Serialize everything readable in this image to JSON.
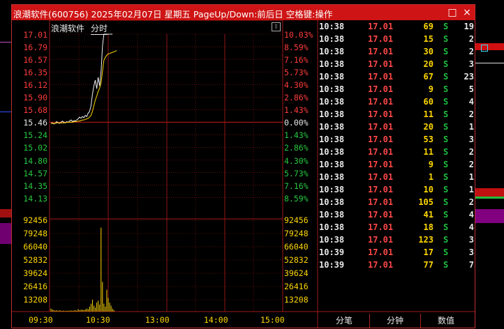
{
  "window": {
    "title": "浪潮软件(600756) 2025年02月07日 星期五 PageUp/Down:前后日 空格键:操作",
    "buttons": {
      "restore": "□",
      "close": "×"
    }
  },
  "chart": {
    "stock_name": "浪潮软件",
    "mode": "分时",
    "price_ticks": [
      "17.01",
      "16.79",
      "16.57",
      "16.35",
      "16.12",
      "15.90",
      "15.68",
      "15.46",
      "15.24",
      "15.02",
      "14.80",
      "14.57",
      "14.35",
      "14.13"
    ],
    "pct_ticks": [
      "10.03%",
      "8.59%",
      "7.16%",
      "5.73%",
      "4.30%",
      "2.86%",
      "1.43%",
      "0.00%",
      "1.43%",
      "2.86%",
      "4.30%",
      "5.73%",
      "7.16%",
      "8.59%"
    ],
    "volume_ticks": [
      "92456",
      "79248",
      "66040",
      "52832",
      "39624",
      "26416",
      "13208"
    ],
    "time_ticks": [
      "09:30",
      "10:30",
      "13:00",
      "14:00",
      "15:00"
    ],
    "colors": {
      "up": "#ff3b3b",
      "down": "#27c840",
      "flat": "#e8e8e8",
      "grid": "#a01818",
      "volume": "#ffd700"
    }
  },
  "trades": [
    {
      "time": "10:38",
      "price": "17.01",
      "vol": "69",
      "bs": "S",
      "count": "19"
    },
    {
      "time": "10:38",
      "price": "17.01",
      "vol": "15",
      "bs": "S",
      "count": "2"
    },
    {
      "time": "10:38",
      "price": "17.01",
      "vol": "30",
      "bs": "S",
      "count": "2"
    },
    {
      "time": "10:38",
      "price": "17.01",
      "vol": "20",
      "bs": "S",
      "count": "3"
    },
    {
      "time": "10:38",
      "price": "17.01",
      "vol": "67",
      "bs": "S",
      "count": "23"
    },
    {
      "time": "10:38",
      "price": "17.01",
      "vol": "9",
      "bs": "S",
      "count": "5"
    },
    {
      "time": "10:38",
      "price": "17.01",
      "vol": "60",
      "bs": "S",
      "count": "4"
    },
    {
      "time": "10:38",
      "price": "17.01",
      "vol": "11",
      "bs": "S",
      "count": "2"
    },
    {
      "time": "10:38",
      "price": "17.01",
      "vol": "20",
      "bs": "S",
      "count": "1"
    },
    {
      "time": "10:38",
      "price": "17.01",
      "vol": "53",
      "bs": "S",
      "count": "3"
    },
    {
      "time": "10:38",
      "price": "17.01",
      "vol": "11",
      "bs": "S",
      "count": "2"
    },
    {
      "time": "10:38",
      "price": "17.01",
      "vol": "9",
      "bs": "S",
      "count": "2"
    },
    {
      "time": "10:38",
      "price": "17.01",
      "vol": "1",
      "bs": "S",
      "count": "1"
    },
    {
      "time": "10:38",
      "price": "17.01",
      "vol": "10",
      "bs": "S",
      "count": "1"
    },
    {
      "time": "10:38",
      "price": "17.01",
      "vol": "105",
      "bs": "S",
      "count": "2"
    },
    {
      "time": "10:38",
      "price": "17.01",
      "vol": "41",
      "bs": "S",
      "count": "4"
    },
    {
      "time": "10:38",
      "price": "17.01",
      "vol": "18",
      "bs": "S",
      "count": "4"
    },
    {
      "time": "10:38",
      "price": "17.01",
      "vol": "123",
      "bs": "S",
      "count": "3"
    },
    {
      "time": "10:39",
      "price": "17.01",
      "vol": "17",
      "bs": "S",
      "count": "3"
    },
    {
      "time": "10:39",
      "price": "17.01",
      "vol": "77",
      "bs": "S",
      "count": "7"
    }
  ],
  "tabs": [
    "分笔",
    "分钟",
    "数值"
  ]
}
